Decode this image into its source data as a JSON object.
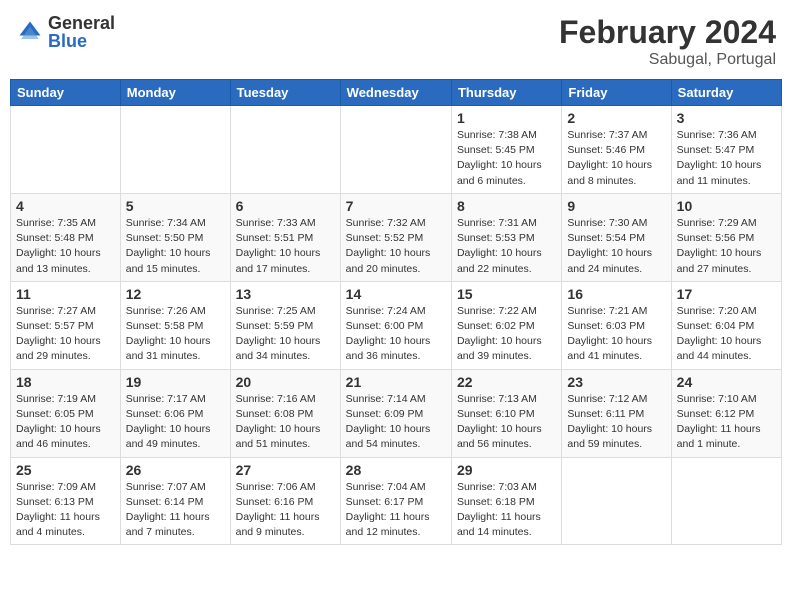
{
  "header": {
    "logo_general": "General",
    "logo_blue": "Blue",
    "month_year": "February 2024",
    "location": "Sabugal, Portugal"
  },
  "weekdays": [
    "Sunday",
    "Monday",
    "Tuesday",
    "Wednesday",
    "Thursday",
    "Friday",
    "Saturday"
  ],
  "weeks": [
    [
      {
        "day": "",
        "info": ""
      },
      {
        "day": "",
        "info": ""
      },
      {
        "day": "",
        "info": ""
      },
      {
        "day": "",
        "info": ""
      },
      {
        "day": "1",
        "info": "Sunrise: 7:38 AM\nSunset: 5:45 PM\nDaylight: 10 hours\nand 6 minutes."
      },
      {
        "day": "2",
        "info": "Sunrise: 7:37 AM\nSunset: 5:46 PM\nDaylight: 10 hours\nand 8 minutes."
      },
      {
        "day": "3",
        "info": "Sunrise: 7:36 AM\nSunset: 5:47 PM\nDaylight: 10 hours\nand 11 minutes."
      }
    ],
    [
      {
        "day": "4",
        "info": "Sunrise: 7:35 AM\nSunset: 5:48 PM\nDaylight: 10 hours\nand 13 minutes."
      },
      {
        "day": "5",
        "info": "Sunrise: 7:34 AM\nSunset: 5:50 PM\nDaylight: 10 hours\nand 15 minutes."
      },
      {
        "day": "6",
        "info": "Sunrise: 7:33 AM\nSunset: 5:51 PM\nDaylight: 10 hours\nand 17 minutes."
      },
      {
        "day": "7",
        "info": "Sunrise: 7:32 AM\nSunset: 5:52 PM\nDaylight: 10 hours\nand 20 minutes."
      },
      {
        "day": "8",
        "info": "Sunrise: 7:31 AM\nSunset: 5:53 PM\nDaylight: 10 hours\nand 22 minutes."
      },
      {
        "day": "9",
        "info": "Sunrise: 7:30 AM\nSunset: 5:54 PM\nDaylight: 10 hours\nand 24 minutes."
      },
      {
        "day": "10",
        "info": "Sunrise: 7:29 AM\nSunset: 5:56 PM\nDaylight: 10 hours\nand 27 minutes."
      }
    ],
    [
      {
        "day": "11",
        "info": "Sunrise: 7:27 AM\nSunset: 5:57 PM\nDaylight: 10 hours\nand 29 minutes."
      },
      {
        "day": "12",
        "info": "Sunrise: 7:26 AM\nSunset: 5:58 PM\nDaylight: 10 hours\nand 31 minutes."
      },
      {
        "day": "13",
        "info": "Sunrise: 7:25 AM\nSunset: 5:59 PM\nDaylight: 10 hours\nand 34 minutes."
      },
      {
        "day": "14",
        "info": "Sunrise: 7:24 AM\nSunset: 6:00 PM\nDaylight: 10 hours\nand 36 minutes."
      },
      {
        "day": "15",
        "info": "Sunrise: 7:22 AM\nSunset: 6:02 PM\nDaylight: 10 hours\nand 39 minutes."
      },
      {
        "day": "16",
        "info": "Sunrise: 7:21 AM\nSunset: 6:03 PM\nDaylight: 10 hours\nand 41 minutes."
      },
      {
        "day": "17",
        "info": "Sunrise: 7:20 AM\nSunset: 6:04 PM\nDaylight: 10 hours\nand 44 minutes."
      }
    ],
    [
      {
        "day": "18",
        "info": "Sunrise: 7:19 AM\nSunset: 6:05 PM\nDaylight: 10 hours\nand 46 minutes."
      },
      {
        "day": "19",
        "info": "Sunrise: 7:17 AM\nSunset: 6:06 PM\nDaylight: 10 hours\nand 49 minutes."
      },
      {
        "day": "20",
        "info": "Sunrise: 7:16 AM\nSunset: 6:08 PM\nDaylight: 10 hours\nand 51 minutes."
      },
      {
        "day": "21",
        "info": "Sunrise: 7:14 AM\nSunset: 6:09 PM\nDaylight: 10 hours\nand 54 minutes."
      },
      {
        "day": "22",
        "info": "Sunrise: 7:13 AM\nSunset: 6:10 PM\nDaylight: 10 hours\nand 56 minutes."
      },
      {
        "day": "23",
        "info": "Sunrise: 7:12 AM\nSunset: 6:11 PM\nDaylight: 10 hours\nand 59 minutes."
      },
      {
        "day": "24",
        "info": "Sunrise: 7:10 AM\nSunset: 6:12 PM\nDaylight: 11 hours\nand 1 minute."
      }
    ],
    [
      {
        "day": "25",
        "info": "Sunrise: 7:09 AM\nSunset: 6:13 PM\nDaylight: 11 hours\nand 4 minutes."
      },
      {
        "day": "26",
        "info": "Sunrise: 7:07 AM\nSunset: 6:14 PM\nDaylight: 11 hours\nand 7 minutes."
      },
      {
        "day": "27",
        "info": "Sunrise: 7:06 AM\nSunset: 6:16 PM\nDaylight: 11 hours\nand 9 minutes."
      },
      {
        "day": "28",
        "info": "Sunrise: 7:04 AM\nSunset: 6:17 PM\nDaylight: 11 hours\nand 12 minutes."
      },
      {
        "day": "29",
        "info": "Sunrise: 7:03 AM\nSunset: 6:18 PM\nDaylight: 11 hours\nand 14 minutes."
      },
      {
        "day": "",
        "info": ""
      },
      {
        "day": "",
        "info": ""
      }
    ]
  ]
}
